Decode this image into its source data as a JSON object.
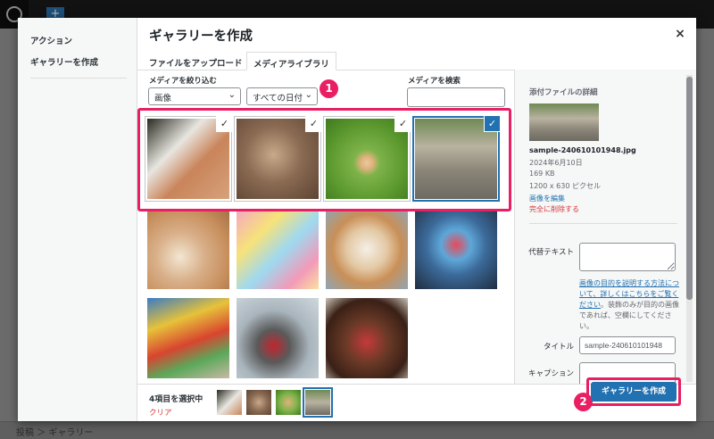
{
  "wp_bar": {
    "breadcrumb": "投稿 ＞ ギャラリー"
  },
  "menu": {
    "action_label": "アクション",
    "create_gallery_label": "ギャラリーを作成"
  },
  "modal": {
    "title": "ギャラリーを作成",
    "close_label": "×"
  },
  "tabs": [
    {
      "label": "ファイルをアップロード"
    },
    {
      "label": "メディアライブラリ",
      "active": true
    }
  ],
  "filter": {
    "label": "メディアを絞り込む",
    "type_selected": "画像",
    "date_selected": "すべての日付",
    "search_label": "メディアを検索",
    "search_value": ""
  },
  "annotations": {
    "step1": "1",
    "step2": "2"
  },
  "grid": {
    "items": [
      {
        "name": "cat-petted-photo",
        "selected": true
      },
      {
        "name": "cat-lying-photo",
        "selected": true
      },
      {
        "name": "kitten-grass-photo",
        "selected": true
      },
      {
        "name": "two-cats-photo",
        "selected": true,
        "current": true
      },
      {
        "name": "cookies-photo",
        "selected": false
      },
      {
        "name": "candy-hearts-photo",
        "selected": false
      },
      {
        "name": "cream-puffs-photo",
        "selected": false
      },
      {
        "name": "toy-balls-photo",
        "selected": false
      },
      {
        "name": "crayons-photo",
        "selected": false
      },
      {
        "name": "pliers-photo",
        "selected": false
      },
      {
        "name": "chocolate-strawberries-photo",
        "selected": false
      }
    ],
    "check_glyph": "✓"
  },
  "details": {
    "heading": "添付ファイルの詳細",
    "filename": "sample-240610101948.jpg",
    "date": "2024年6月10日",
    "filesize": "169 KB",
    "dimensions": "1200 x 630 ピクセル",
    "edit_link": "画像を編集",
    "delete_link": "完全に削除する",
    "alt_label": "代替テキスト",
    "alt_value": "",
    "help_link": "画像の目的を説明する方法について、詳しくはこちらをご覧ください",
    "help_text": "。装飾のみが目的の画像であれば、空欄にしてください。",
    "title_label": "タイトル",
    "title_value": "sample-240610101948",
    "caption_label": "キャプション",
    "caption_value": ""
  },
  "toolbar": {
    "selected_count": "4項目を選択中",
    "clear_label": "クリア",
    "create_button": "ギャラリーを作成"
  }
}
